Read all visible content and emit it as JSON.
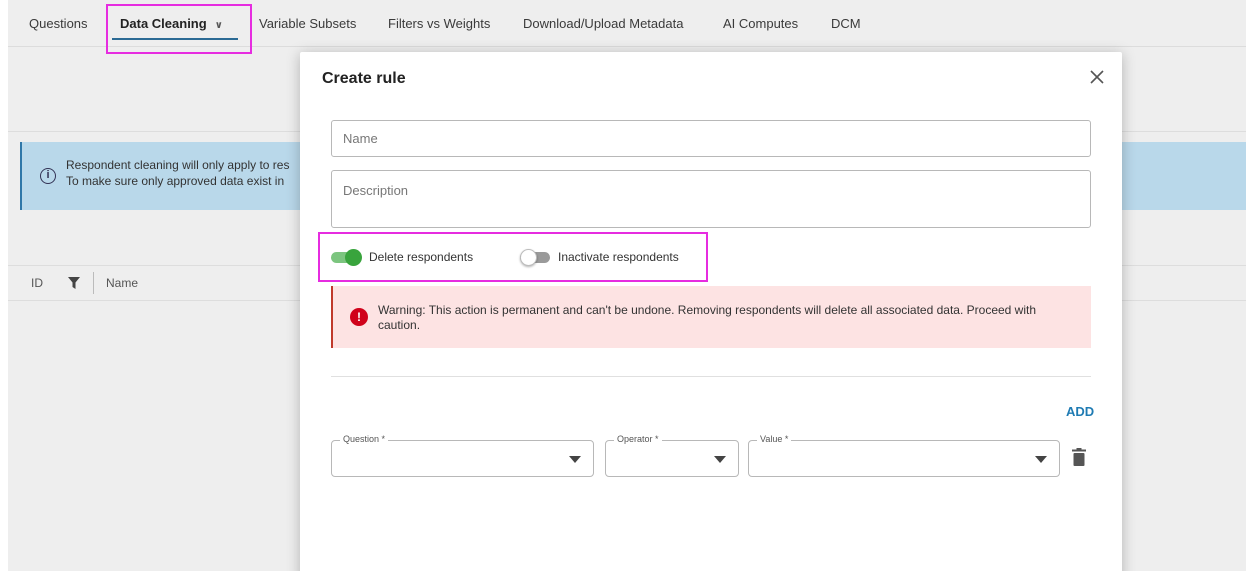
{
  "tabs": [
    {
      "label": "Questions"
    },
    {
      "label": "Data Cleaning"
    },
    {
      "label": "Variable Subsets"
    },
    {
      "label": "Filters vs Weights"
    },
    {
      "label": "Download/Upload Metadata"
    },
    {
      "label": "AI Computes"
    },
    {
      "label": "DCM"
    }
  ],
  "active_tab": "Data Cleaning",
  "background": {
    "info_line1": "Respondent cleaning will only apply to res",
    "info_line2": "To make sure only approved data exist in",
    "columns": {
      "id": "ID",
      "name": "Name"
    }
  },
  "modal": {
    "title": "Create rule",
    "name_placeholder": "Name",
    "description_placeholder": "Description",
    "toggles": {
      "delete_label": "Delete respondents",
      "delete_on": true,
      "inactivate_label": "Inactivate respondents",
      "inactivate_on": false
    },
    "warning": "Warning: This action is permanent and can't be undone. Removing respondents will delete all associated data. Proceed with caution.",
    "add_label": "ADD",
    "condition": {
      "question_label": "Question *",
      "operator_label": "Operator *",
      "value_label": "Value *"
    }
  },
  "colors": {
    "accent_blue": "#1f7bb3",
    "toggle_green": "#39a43d",
    "warning_bg": "#fde3e3",
    "info_bg": "#b9d8ea",
    "highlight": "#e62ce0"
  }
}
